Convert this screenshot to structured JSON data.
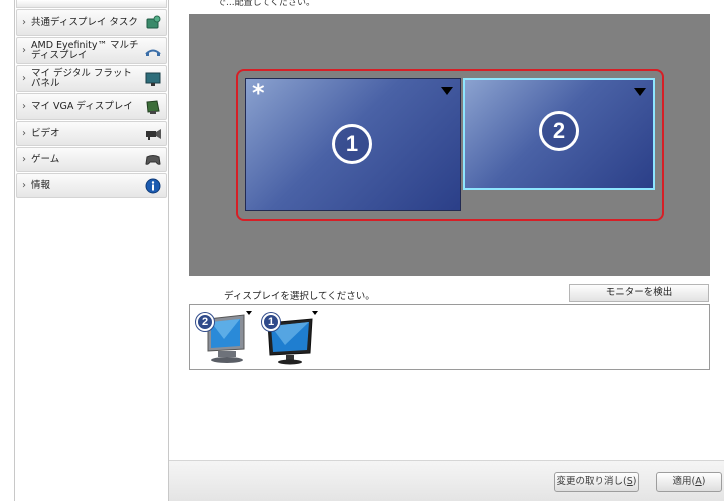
{
  "sidebar": {
    "items": [
      {
        "label": "共通ディスプレイ タスク",
        "icon": "display-tasks-icon"
      },
      {
        "label": "AMD Eyefinity™ マルチディスプレイ",
        "icon": "eyefinity-icon"
      },
      {
        "label": "マイ デジタル フラットパネル",
        "icon": "flat-panel-icon"
      },
      {
        "label": "マイ VGA ディスプレイ",
        "icon": "vga-display-icon"
      },
      {
        "label": "ビデオ",
        "icon": "video-camera-icon"
      },
      {
        "label": "ゲーム",
        "icon": "gamepad-icon"
      },
      {
        "label": "情報",
        "icon": "info-icon"
      }
    ]
  },
  "main": {
    "top_text": "で...配置してください。",
    "arrangement": {
      "monitors": [
        {
          "number": "1",
          "primary_mark": "*"
        },
        {
          "number": "2",
          "primary_mark": ""
        }
      ],
      "group_frame_color": "#d61f26",
      "selected_border_color": "#8ee6ff"
    },
    "select_label": "ディスプレイを選択してください。",
    "detect_button": "モニターを検出",
    "display_list": [
      {
        "number": "2",
        "type": "crt-monitor-icon"
      },
      {
        "number": "1",
        "type": "lcd-monitor-icon"
      }
    ]
  },
  "bottom": {
    "cancel_label": "変更の取り消し(",
    "cancel_key": "S",
    "cancel_suffix": ")",
    "apply_label": "適用(",
    "apply_key": "A",
    "apply_suffix": ")"
  }
}
